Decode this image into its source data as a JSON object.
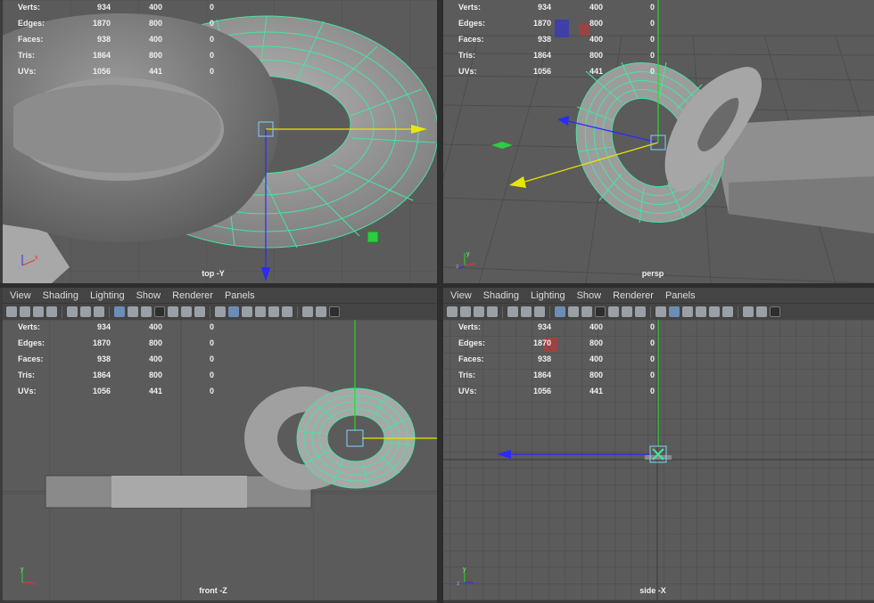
{
  "hud": {
    "rows": [
      {
        "label": "Verts:",
        "v1": "934",
        "v2": "400",
        "v3": "0"
      },
      {
        "label": "Edges:",
        "v1": "1870",
        "v2": "800",
        "v3": "0"
      },
      {
        "label": "Faces:",
        "v1": "938",
        "v2": "400",
        "v3": "0"
      },
      {
        "label": "Tris:",
        "v1": "1864",
        "v2": "800",
        "v3": "0"
      },
      {
        "label": "UVs:",
        "v1": "1056",
        "v2": "441",
        "v3": "0"
      }
    ]
  },
  "menu": {
    "view": "View",
    "shading": "Shading",
    "lighting": "Lighting",
    "show": "Show",
    "renderer": "Renderer",
    "panels": "Panels"
  },
  "viewports": {
    "top": "top -Y",
    "persp": "persp",
    "front": "front -Z",
    "side": "side -X"
  },
  "axis": {
    "x": "x",
    "y": "y",
    "z": "z"
  },
  "colors": {
    "viewport_bg": "#5b5b5b",
    "wireframe": "#49e3a0",
    "x_axis": "#e8e800",
    "y_axis": "#22dd22",
    "z_axis": "#2a2aff"
  }
}
